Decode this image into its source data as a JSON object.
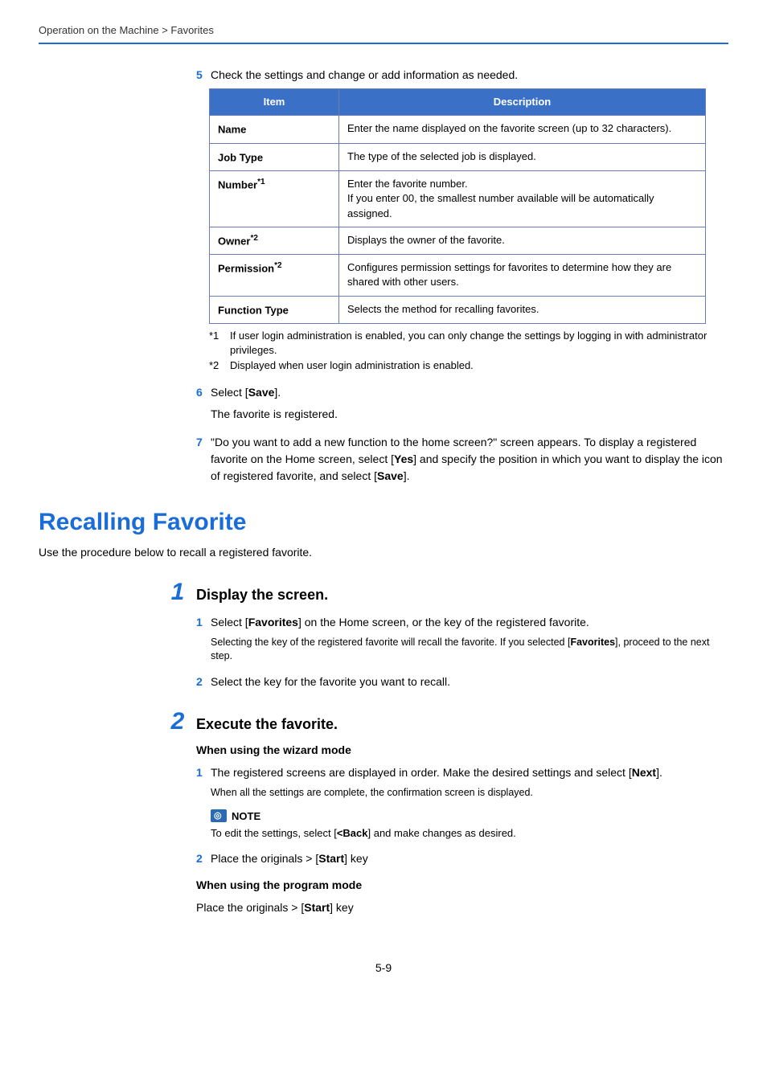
{
  "breadcrumb": "Operation on the Machine > Favorites",
  "step5": {
    "num": "5",
    "text": "Check the settings and change or add information as needed."
  },
  "table": {
    "head_item": "Item",
    "head_desc": "Description",
    "rows": [
      {
        "item": "Name",
        "sup": "",
        "desc": "Enter the name displayed on the favorite screen (up to 32 characters)."
      },
      {
        "item": "Job Type",
        "sup": "",
        "desc": "The type of the selected job is displayed."
      },
      {
        "item": "Number",
        "sup": "*1",
        "desc": "Enter the favorite number.\nIf you enter 00, the smallest number available will be automatically assigned."
      },
      {
        "item": "Owner",
        "sup": "*2",
        "desc": "Displays the owner of the favorite."
      },
      {
        "item": "Permission",
        "sup": "*2",
        "desc": "Configures permission settings for favorites to determine how they are shared with other users."
      },
      {
        "item": "Function Type",
        "sup": "",
        "desc": "Selects the method for recalling favorites."
      }
    ]
  },
  "footnotes": [
    {
      "mark": "*1",
      "text": "If user login administration is enabled, you can only change the settings by logging in with administrator privileges."
    },
    {
      "mark": "*2",
      "text": "Displayed when user login administration is enabled."
    }
  ],
  "step6": {
    "num": "6",
    "pre": "Select [",
    "bold": "Save",
    "post": "].",
    "body": "The favorite is registered."
  },
  "step7": {
    "num": "7",
    "p1": "\"Do you want to add a new function to the home screen?\" screen appears. To display a registered favorite on the Home screen, select [",
    "b1": "Yes",
    "p2": "] and specify the position in which you want to display the icon of registered favorite, and select [",
    "b2": "Save",
    "p3": "]."
  },
  "section_title": "Recalling Favorite",
  "section_intro": "Use the procedure below to recall a registered favorite.",
  "big1": {
    "num": "1",
    "title": "Display the screen."
  },
  "b1_s1": {
    "num": "1",
    "pre": "Select [",
    "bold": "Favorites",
    "post": "] on the Home screen, or the key of the registered favorite.",
    "small_pre": "Selecting the key of the registered favorite will recall the favorite. If you selected [",
    "small_bold": "Favorites",
    "small_post": "], proceed to the next step."
  },
  "b1_s2": {
    "num": "2",
    "text": "Select the key for the favorite you want to recall."
  },
  "big2": {
    "num": "2",
    "title": "Execute the favorite."
  },
  "wizard_mode_head": "When using the wizard mode",
  "b2_s1": {
    "num": "1",
    "pre": "The registered screens are displayed in order. Make the desired settings and select [",
    "bold": "Next",
    "post": "].",
    "small": "When all the settings are complete, the confirmation screen is displayed."
  },
  "note": {
    "label": "NOTE",
    "pre": "To edit the settings, select [",
    "bold": "<Back",
    "post": "] and make changes as desired."
  },
  "b2_s2": {
    "num": "2",
    "pre": "Place the originals > [",
    "bold": "Start",
    "post": "] key"
  },
  "program_mode_head": "When using the program mode",
  "program_mode": {
    "pre": "Place the originals > [",
    "bold": "Start",
    "post": "] key"
  },
  "page_num": "5-9"
}
